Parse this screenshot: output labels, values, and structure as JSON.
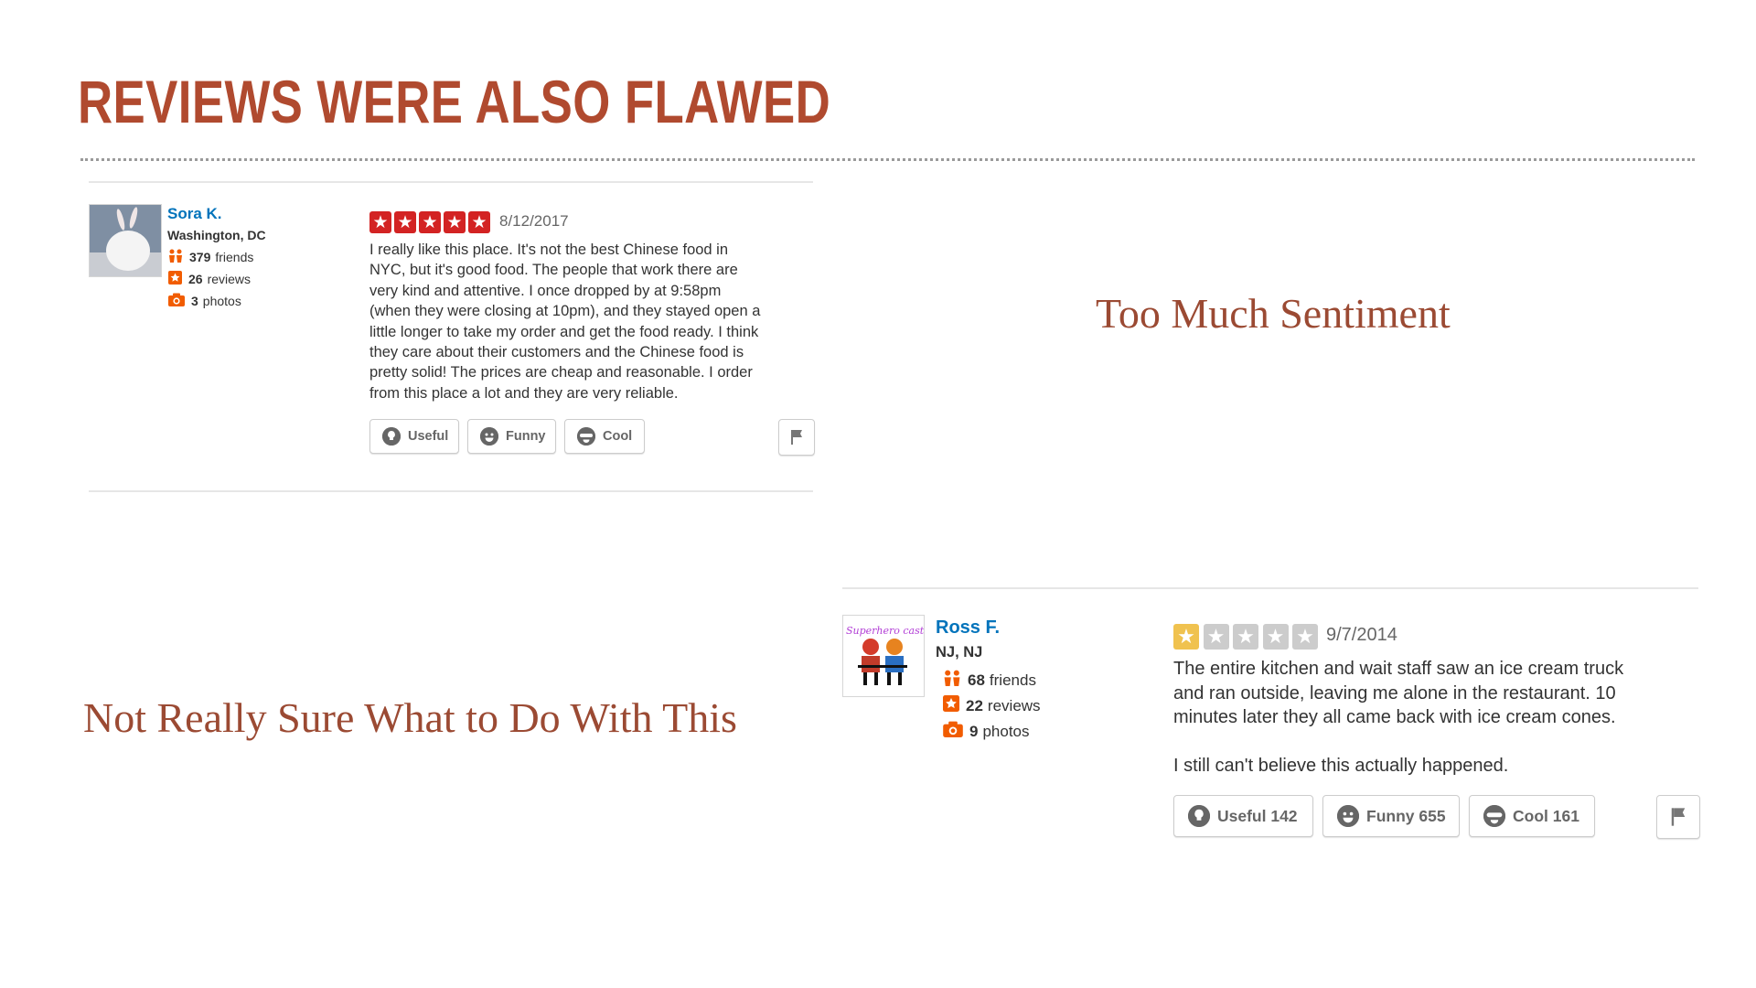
{
  "slide": {
    "title": "REVIEWS WERE ALSO FLAWED",
    "caption_right": "Too Much Sentiment",
    "caption_left": "Not Really Sure What to Do With This"
  },
  "review1": {
    "user_name": "Sora K.",
    "location": "Washington, DC",
    "friends_count": "379",
    "friends_label": "friends",
    "reviews_count": "26",
    "reviews_label": "reviews",
    "photos_count": "3",
    "photos_label": "photos",
    "rating": 5,
    "date": "8/12/2017",
    "text": "I really like this place.  It's not the best Chinese food in\nNYC, but it's good food.  The people that work there are\nvery kind and attentive.  I once dropped by at 9:58pm\n(when they were closing at 10pm), and they stayed open a\nlittle longer to take my order and get the food ready.  I think\nthey care about their customers and the Chinese food is\npretty solid!  The prices are cheap and reasonable.  I order\nfrom this place a lot and they are very reliable.",
    "useful_label": "Useful",
    "funny_label": "Funny",
    "cool_label": "Cool",
    "star_color": "#d32323"
  },
  "review2": {
    "user_name": "Ross F.",
    "location": "NJ, NJ",
    "friends_count": "68",
    "friends_label": "friends",
    "reviews_count": "22",
    "reviews_label": "reviews",
    "photos_count": "9",
    "photos_label": "photos",
    "avatar_text": "Superhero cast",
    "rating": 1,
    "date": "9/7/2014",
    "text": "The entire kitchen and wait staff saw an ice cream truck\nand ran outside, leaving me alone in the restaurant. 10\nminutes later they all came back with ice cream cones.\n\nI still can't believe this actually happened.",
    "useful_label": "Useful 142",
    "funny_label": "Funny 655",
    "cool_label": "Cool 161",
    "star_color": "#f0c24f"
  },
  "colors": {
    "title": "#b04a2f",
    "caption": "#9b4a33",
    "link": "#0073bb",
    "star_empty": "#cccccc",
    "icon_orange": "#f15c00"
  }
}
